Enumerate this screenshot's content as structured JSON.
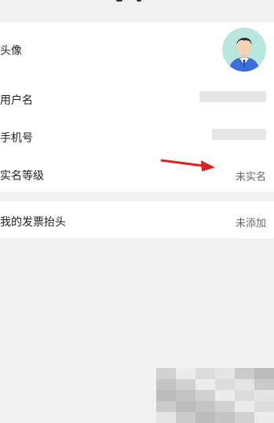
{
  "profile": {
    "avatar_label": "头像",
    "avatar_icon": "user-avatar-icon",
    "username_label": "用户名",
    "phone_label": "手机号",
    "realname_label": "实名等级",
    "realname_value": "未实名"
  },
  "invoice": {
    "label": "我的发票抬头",
    "value": "未添加"
  },
  "colors": {
    "page_bg": "#f2f2f2",
    "card_bg": "#ffffff",
    "arrow_red": "#e02020",
    "avatar_bg": "#b9e7de",
    "suit_blue": "#3a6fd8"
  }
}
